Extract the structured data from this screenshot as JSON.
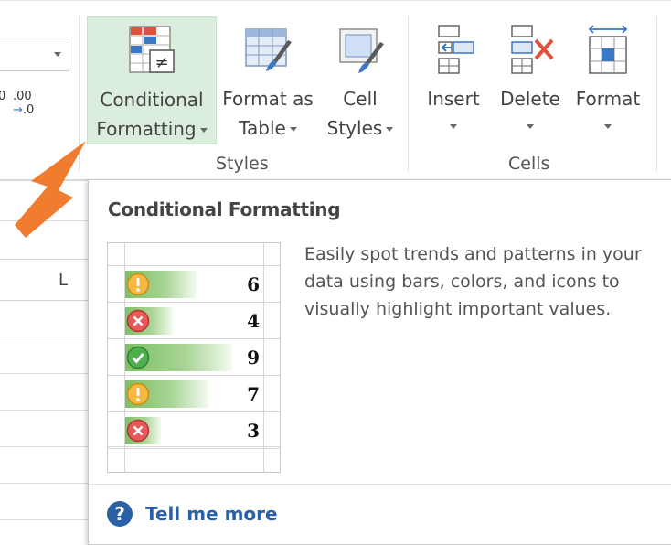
{
  "ribbon": {
    "number_group": {
      "increase_decimal": ".00",
      "decrease_decimal": ".0"
    },
    "styles_group": {
      "label": "Styles",
      "buttons": [
        {
          "line1": "Conditional",
          "line2": "Formatting",
          "icon": "conditional-formatting-icon",
          "selected": true
        },
        {
          "line1": "Format as",
          "line2": "Table",
          "icon": "format-as-table-icon"
        },
        {
          "line1": "Cell",
          "line2": "Styles",
          "icon": "cell-styles-icon"
        }
      ]
    },
    "cells_group": {
      "label": "Cells",
      "buttons": [
        {
          "line1": "Insert",
          "icon": "insert-cells-icon"
        },
        {
          "line1": "Delete",
          "icon": "delete-cells-icon"
        },
        {
          "line1": "Format",
          "icon": "format-cells-icon"
        }
      ]
    }
  },
  "sheet": {
    "column_header": "L"
  },
  "tooltip": {
    "title": "Conditional Formatting",
    "description": "Easily spot trends and patterns in your data using bars, colors, and icons to visually highlight important values.",
    "preview_rows": [
      {
        "icon": "warning-icon",
        "value": "6",
        "fraction": 0.6
      },
      {
        "icon": "error-icon",
        "value": "4",
        "fraction": 0.4
      },
      {
        "icon": "check-icon",
        "value": "9",
        "fraction": 0.9
      },
      {
        "icon": "warning-icon",
        "value": "7",
        "fraction": 0.7
      },
      {
        "icon": "error-icon",
        "value": "3",
        "fraction": 0.3
      }
    ],
    "help_link": "Tell me more"
  },
  "colors": {
    "selected_button_bg": "#dbeedd",
    "callout_arrow": "#f07c30",
    "link": "#2a61a6",
    "bar_green": "#7cc063"
  }
}
